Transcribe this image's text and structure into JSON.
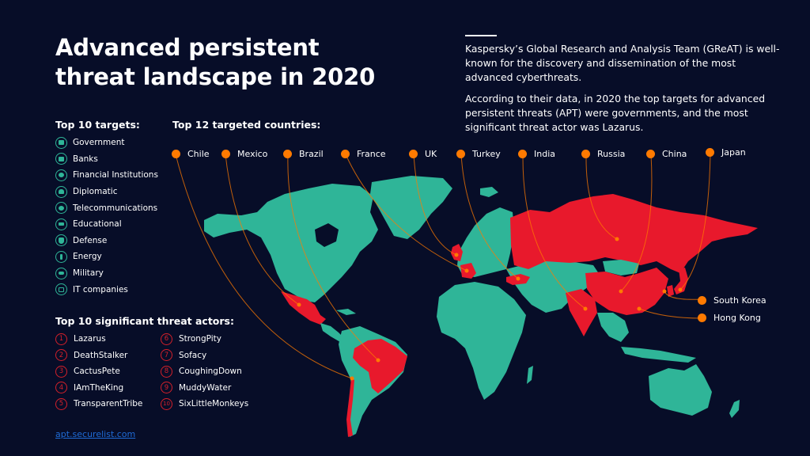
{
  "header": {
    "title_line1": "Advanced persistent",
    "title_line2": "threat landscape in 2020"
  },
  "intro": {
    "paragraph1": "Kaspersky’s Global Research and Analysis Team (GReAT) is well-known for the discovery and dissemination of the most advanced cyberthreats.",
    "paragraph2": "According to their data, in 2020 the top targets for advanced persistent threats (APT) were governments, and the most significant threat actor was Lazarus."
  },
  "targets": {
    "heading": "Top 10 targets:",
    "items": [
      {
        "label": "Government",
        "icon": "government-building-icon"
      },
      {
        "label": "Banks",
        "icon": "bank-icon"
      },
      {
        "label": "Financial Institutions",
        "icon": "money-bag-icon"
      },
      {
        "label": "Diplomatic",
        "icon": "diplomat-person-icon"
      },
      {
        "label": "Telecommunications",
        "icon": "telecom-head-icon"
      },
      {
        "label": "Educational",
        "icon": "graduation-cap-icon"
      },
      {
        "label": "Defense",
        "icon": "shield-icon"
      },
      {
        "label": "Energy",
        "icon": "lightning-icon"
      },
      {
        "label": "Military",
        "icon": "tank-icon"
      },
      {
        "label": "IT companies",
        "icon": "monitor-icon"
      }
    ]
  },
  "actors": {
    "heading": "Top 10 significant threat actors:",
    "items": [
      {
        "rank": "1",
        "name": "Lazarus"
      },
      {
        "rank": "2",
        "name": "DeathStalker"
      },
      {
        "rank": "3",
        "name": "CactusPete"
      },
      {
        "rank": "4",
        "name": "IAmTheKing"
      },
      {
        "rank": "5",
        "name": "TransparentTribe"
      },
      {
        "rank": "6",
        "name": "StrongPity"
      },
      {
        "rank": "7",
        "name": "Sofacy"
      },
      {
        "rank": "8",
        "name": "CoughingDown"
      },
      {
        "rank": "9",
        "name": "MuddyWater"
      },
      {
        "rank": "10",
        "name": "SixLittleMonkeys"
      }
    ]
  },
  "countries": {
    "heading": "Top 12 targeted countries:",
    "top_row": [
      "Chile",
      "Mexico",
      "Brazil",
      "France",
      "UK",
      "Turkey",
      "India",
      "Russia",
      "China",
      "Japan"
    ],
    "side": [
      "South Korea",
      "Hong Kong"
    ]
  },
  "footer": {
    "link": "apt.securelist.com"
  },
  "colors": {
    "background": "#070d28",
    "land": "#2fb598",
    "targeted_land": "#e8192c",
    "marker": "#ff7a00",
    "link": "#1f6bd6",
    "actor_accent": "#d4202a"
  }
}
